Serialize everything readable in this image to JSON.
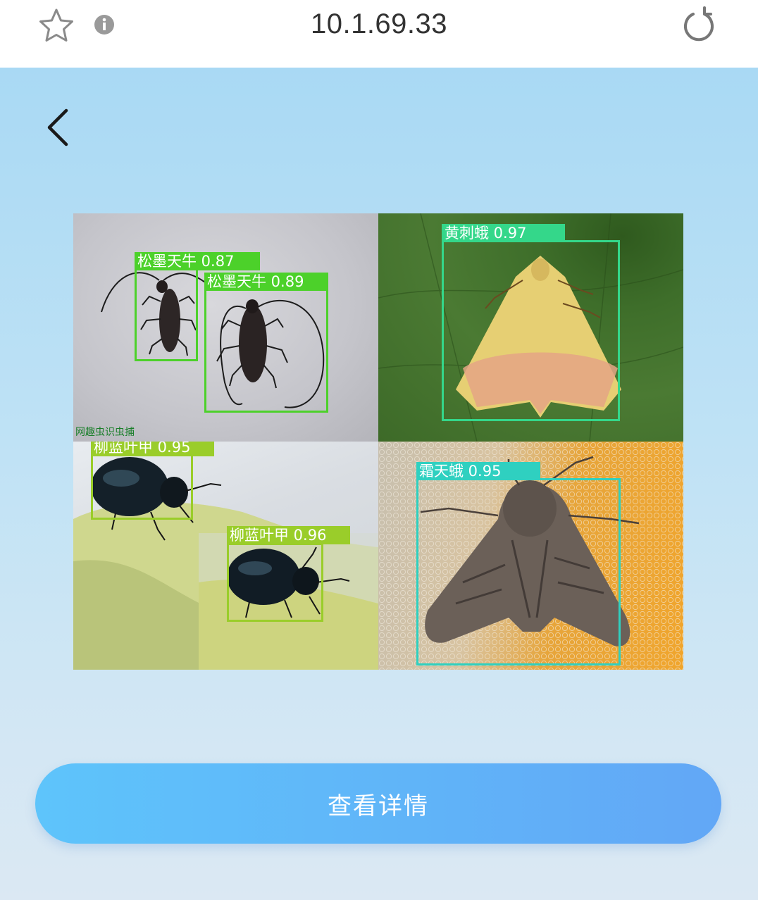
{
  "browser": {
    "url": "10.1.69.33",
    "icons": [
      "star-icon",
      "info-icon",
      "reload-icon"
    ]
  },
  "page": {
    "back_icon": "chevron-left-icon",
    "detections": [
      {
        "label": "松墨天牛 0.87",
        "color": "#4cd12a"
      },
      {
        "label": "松墨天牛 0.89",
        "color": "#4cd12a"
      },
      {
        "label": "黄刺蛾 0.97",
        "color": "#34d78a"
      },
      {
        "label": "柳蓝叶甲 0.95",
        "color": "#9acd2a"
      },
      {
        "label": "柳蓝叶甲 0.96",
        "color": "#9acd2a"
      },
      {
        "label": "霜天蛾 0.95",
        "color": "#2fd0c0"
      }
    ],
    "watermark": "网趣虫识虫捕",
    "details_button": "查看详情"
  }
}
